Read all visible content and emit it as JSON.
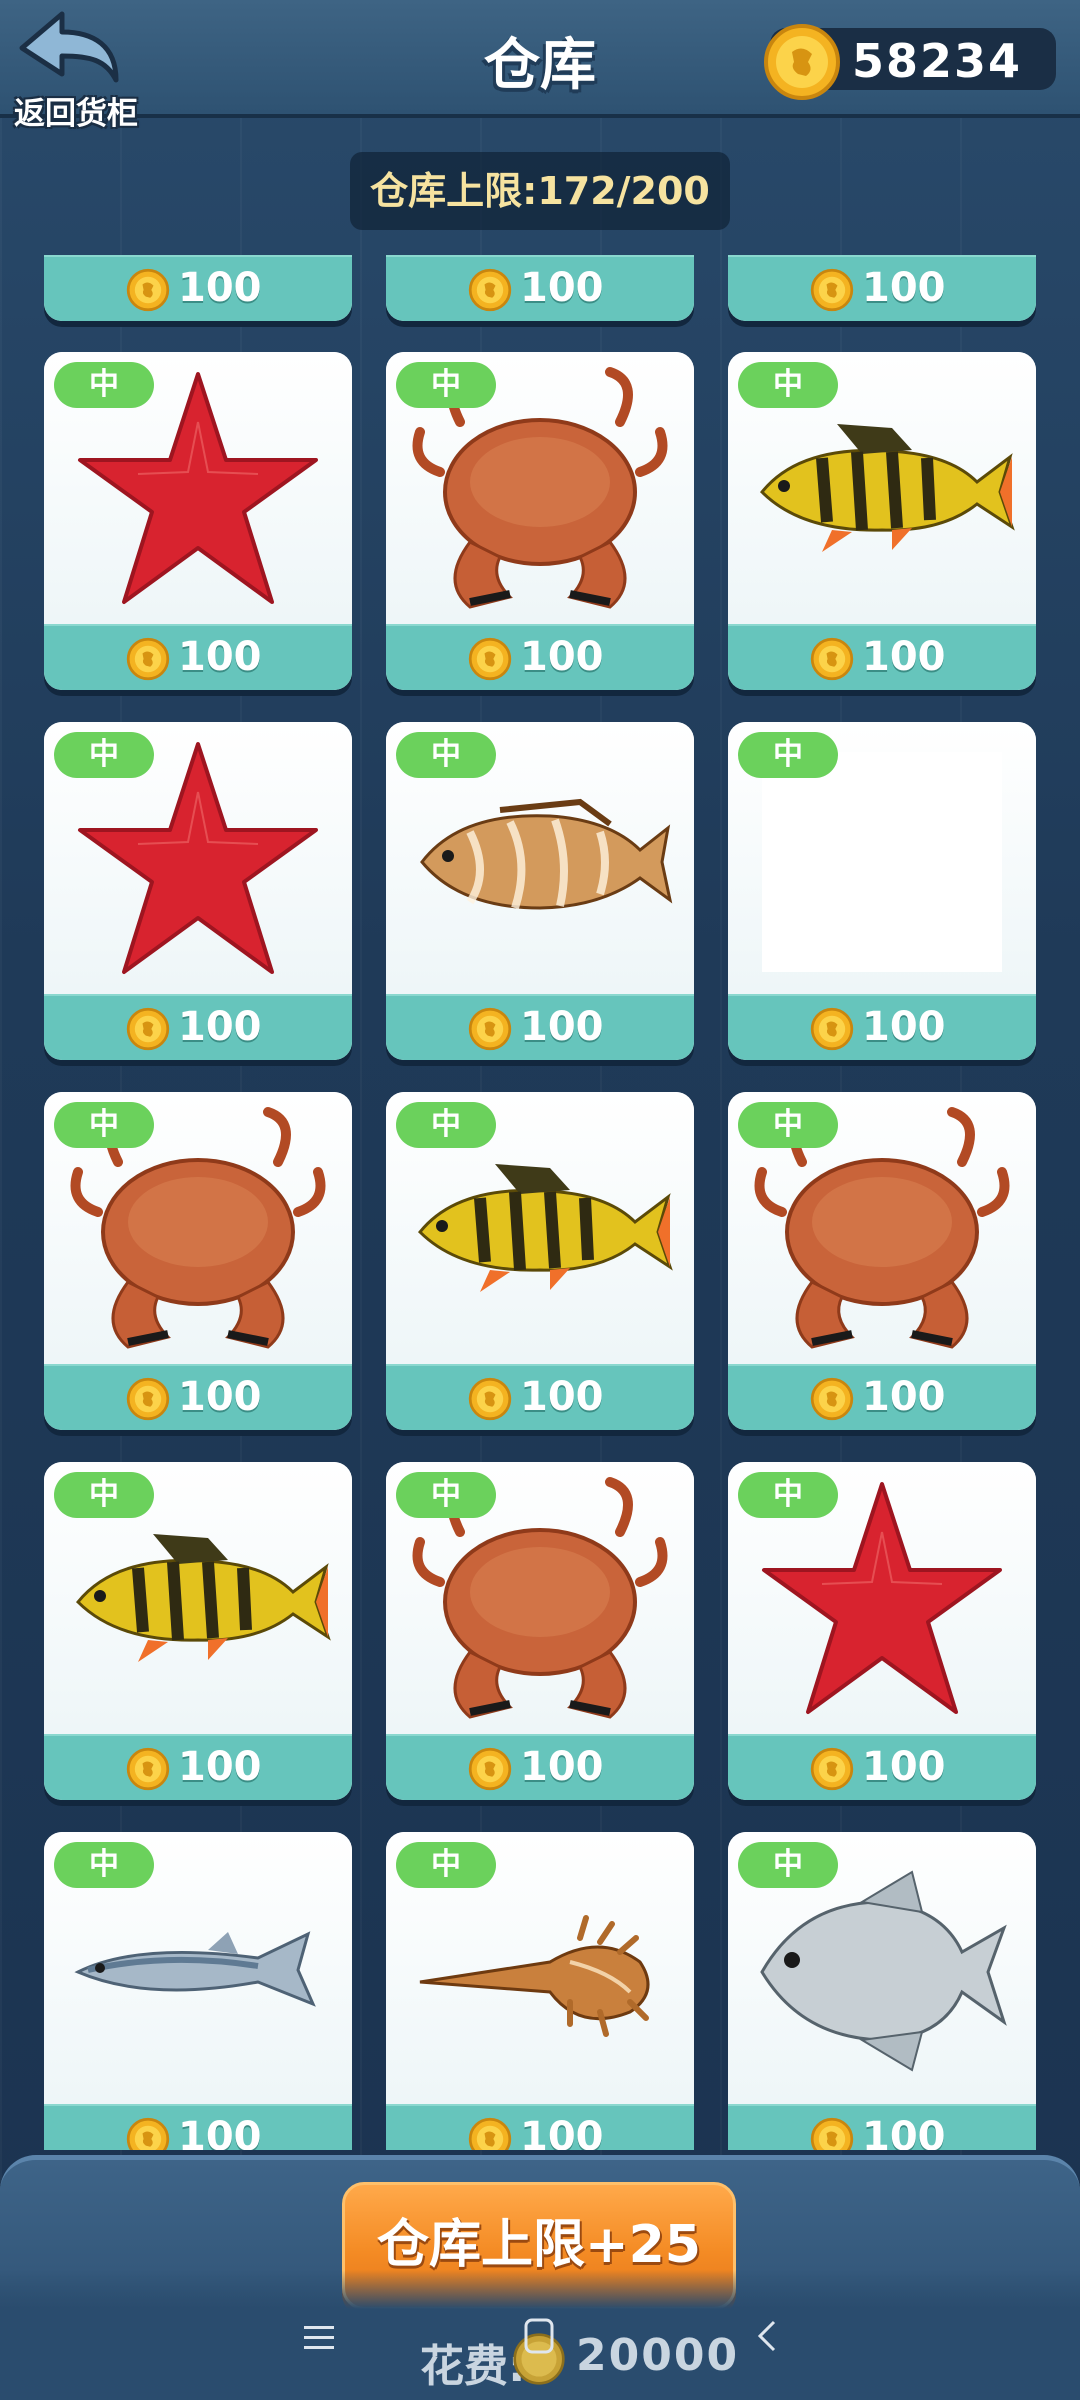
{
  "header": {
    "back_label": "返回货柜",
    "title": "仓库",
    "coins": "58234"
  },
  "capacity": {
    "text": "仓库上限:172/200"
  },
  "grade_label": "中",
  "price": "100",
  "items": [
    {
      "kind": "partial"
    },
    {
      "kind": "partial"
    },
    {
      "kind": "partial"
    },
    {
      "kind": "starfish"
    },
    {
      "kind": "crab"
    },
    {
      "kind": "perch"
    },
    {
      "kind": "starfish"
    },
    {
      "kind": "grouper"
    },
    {
      "kind": "empty"
    },
    {
      "kind": "crab"
    },
    {
      "kind": "perch"
    },
    {
      "kind": "crab"
    },
    {
      "kind": "perch"
    },
    {
      "kind": "crab"
    },
    {
      "kind": "starfish"
    },
    {
      "kind": "sardine"
    },
    {
      "kind": "shell"
    },
    {
      "kind": "pomfret"
    }
  ],
  "bottom": {
    "expand_label": "仓库上限+25",
    "cost_label": "花费:",
    "cost_value": "20000"
  },
  "colors": {
    "accent_orange": "#f48b24",
    "badge_green": "#6bd15c",
    "price_teal": "#66c5bc"
  }
}
